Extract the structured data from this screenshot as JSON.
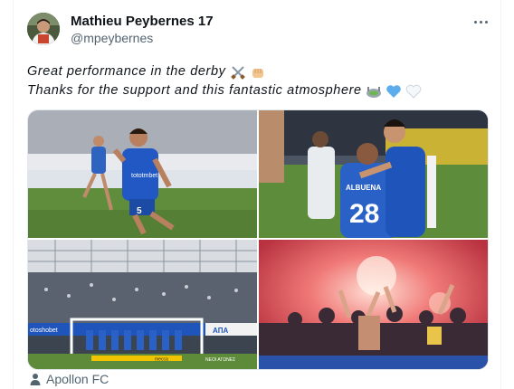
{
  "author": {
    "name": "Mathieu Peybernes 17",
    "handle": "@mpeybernes"
  },
  "tweet": {
    "line1": "Great performance in the derby",
    "line1_emojis": [
      "crossed-swords-icon",
      "raised-fist-icon"
    ],
    "line2": "Thanks for the support and this fantastic atmosphere",
    "line2_emojis": [
      "stadium-icon",
      "blue-heart-icon",
      "white-heart-icon"
    ]
  },
  "photos": [
    {
      "name": "player-celebrating-photo",
      "jersey": "5",
      "sponsor": "tototmbet"
    },
    {
      "name": "players-hugging-photo",
      "jersey": "28",
      "shirt_name": "ALBUENA"
    },
    {
      "name": "team-fans-goal-photo",
      "ad_boards": [
        "otoshobet",
        "mecca",
        "ΑΠΑ",
        "ΝΕΟΙ ΑΓΩΝΕΣ"
      ]
    },
    {
      "name": "fans-flares-photo"
    }
  ],
  "location": {
    "label": "Apollon FC"
  },
  "colors": {
    "text": "#0f1419",
    "secondary": "#536471",
    "apollon_blue": "#1f63c9",
    "border": "#e1e8ed"
  }
}
